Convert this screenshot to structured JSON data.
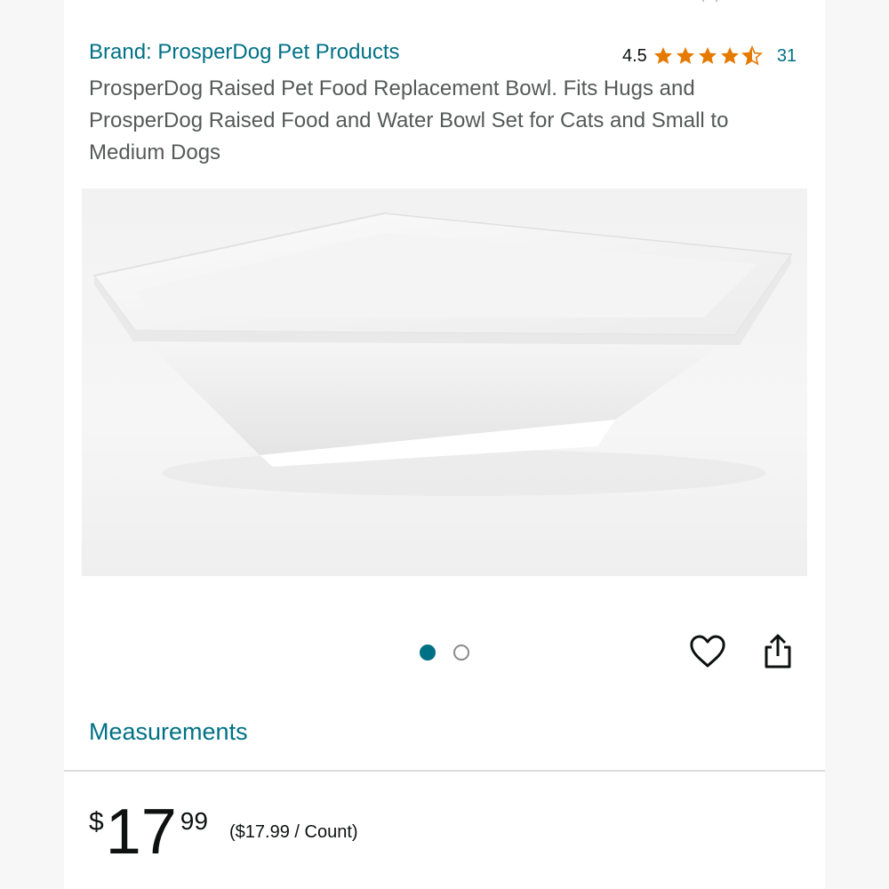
{
  "header": {
    "top_fragment": "· ·"
  },
  "product": {
    "brand_link": "Brand: ProsperDog Pet Products",
    "rating_value": "4.5",
    "rating_stars": 4.5,
    "review_count": "31",
    "title": "ProsperDog Raised Pet Food Replacement Bowl. Fits Hugs and ProsperDog Raised Food and Water Bowl Set for Cats and Small to Medium Dogs",
    "image_alt": "white square ceramic bowl"
  },
  "carousel": {
    "current_index": 1,
    "total": 2
  },
  "icons": {
    "favorite": "heart-icon",
    "share": "share-icon"
  },
  "sections": {
    "measurements_label": "Measurements"
  },
  "pricing": {
    "currency_symbol": "$",
    "whole": "17",
    "fraction": "99",
    "unit_price": "($17.99 / Count)"
  },
  "colors": {
    "link": "#007185",
    "star": "#e67a00",
    "text": "#0f1111",
    "muted": "#565959"
  }
}
